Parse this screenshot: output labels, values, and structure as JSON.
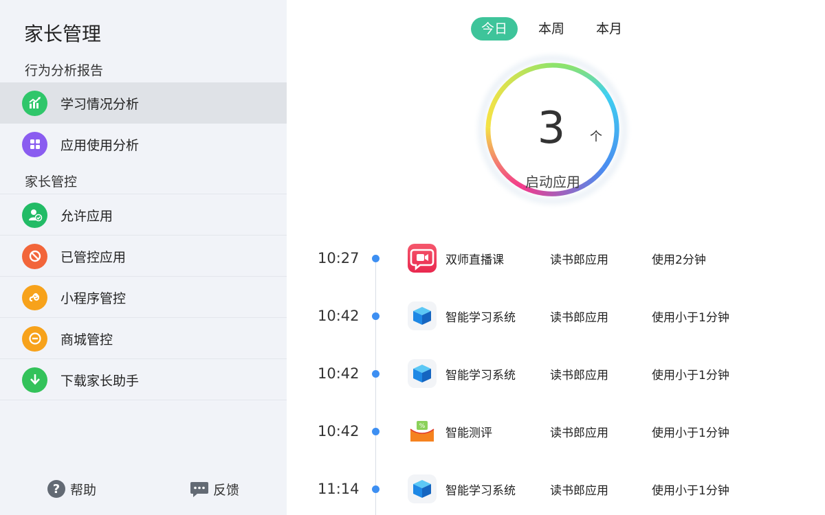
{
  "sidebar": {
    "title": "家长管理",
    "section_behavior": "行为分析报告",
    "section_control": "家长管控",
    "items": [
      {
        "label": "学习情况分析",
        "color": "#2fc66a"
      },
      {
        "label": "应用使用分析",
        "color": "#8a5cf0"
      },
      {
        "label": "允许应用",
        "color": "#22bb66"
      },
      {
        "label": "已管控应用",
        "color": "#f2653a"
      },
      {
        "label": "小程序管控",
        "color": "#f7a21b"
      },
      {
        "label": "商城管控",
        "color": "#f7a21b"
      },
      {
        "label": "下载家长助手",
        "color": "#33c25a"
      }
    ],
    "help_label": "帮助",
    "feedback_label": "反馈"
  },
  "main": {
    "tabs": [
      "今日",
      "本周",
      "本月"
    ],
    "active_tab": "今日",
    "summary": {
      "count": "3",
      "unit": "个",
      "caption": "启动应用"
    },
    "records": [
      {
        "time": "10:27",
        "app": "双师直播课",
        "icon": "video-chat-icon",
        "source": "读书郎应用",
        "duration": "使用2分钟"
      },
      {
        "time": "10:42",
        "app": "智能学习系统",
        "icon": "cube-icon",
        "source": "读书郎应用",
        "duration": "使用小于1分钟"
      },
      {
        "time": "10:42",
        "app": "智能学习系统",
        "icon": "cube-icon",
        "source": "读书郎应用",
        "duration": "使用小于1分钟"
      },
      {
        "time": "10:42",
        "app": "智能测评",
        "icon": "assessment-icon",
        "source": "读书郎应用",
        "duration": "使用小于1分钟"
      },
      {
        "time": "11:14",
        "app": "智能学习系统",
        "icon": "cube-icon",
        "source": "读书郎应用",
        "duration": "使用小于1分钟"
      }
    ]
  },
  "colors": {
    "accent": "#3ec49a",
    "timeline_dot": "#3d8ff2",
    "sidebar_bg": "#f1f3f8"
  }
}
